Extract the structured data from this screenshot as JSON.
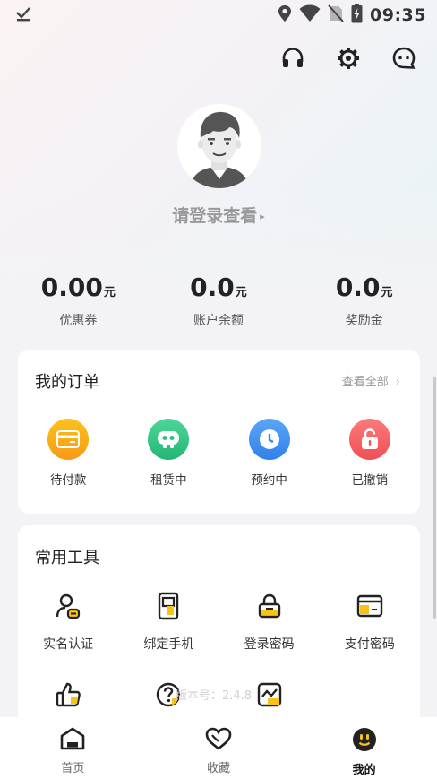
{
  "status_bar": {
    "time": "09:35",
    "icons": [
      "download-done-icon",
      "location-icon",
      "wifi-icon",
      "no-sim-icon",
      "battery-icon"
    ]
  },
  "header_actions": [
    "headset-icon",
    "settings-icon",
    "chat-icon"
  ],
  "profile": {
    "login_text": "请登录查看",
    "arrow": "▸"
  },
  "stats": [
    {
      "value": "0.00",
      "unit": "元",
      "label": "优惠券"
    },
    {
      "value": "0.0",
      "unit": "元",
      "label": "账户余额"
    },
    {
      "value": "0.0",
      "unit": "元",
      "label": "奖励金"
    }
  ],
  "orders": {
    "title": "我的订单",
    "view_all": "查看全部",
    "view_all_chevron": "›",
    "items": [
      {
        "label": "待付款",
        "icon": "wallet-card-icon",
        "color": "#f7a51a"
      },
      {
        "label": "租赁中",
        "icon": "gamepad-icon",
        "color": "#30c283"
      },
      {
        "label": "预约中",
        "icon": "clock-icon",
        "color": "#3e8ef0"
      },
      {
        "label": "已撤销",
        "icon": "lock-icon",
        "color": "#f25f5f"
      }
    ]
  },
  "tools": {
    "title": "常用工具",
    "items": [
      {
        "label": "实名认证",
        "icon": "id-verify-icon"
      },
      {
        "label": "绑定手机",
        "icon": "phone-icon"
      },
      {
        "label": "登录密码",
        "icon": "padlock-icon"
      },
      {
        "label": "支付密码",
        "icon": "payment-card-icon"
      },
      {
        "label": "",
        "icon": "thumbs-up-icon"
      },
      {
        "label": "",
        "icon": "help-question-icon"
      },
      {
        "label": "",
        "icon": "chart-icon"
      }
    ],
    "version": "版本号：2.4.8"
  },
  "bottom_nav": [
    {
      "label": "首页",
      "icon": "home-icon",
      "active": false
    },
    {
      "label": "收藏",
      "icon": "heart-icon",
      "active": false
    },
    {
      "label": "我的",
      "icon": "mine-face-icon",
      "active": true
    }
  ],
  "colors": {
    "accent_yellow": "#f7c21a",
    "orange": "#f7a51a",
    "green": "#30c283",
    "blue": "#3e8ef0",
    "red": "#f25f5f"
  }
}
